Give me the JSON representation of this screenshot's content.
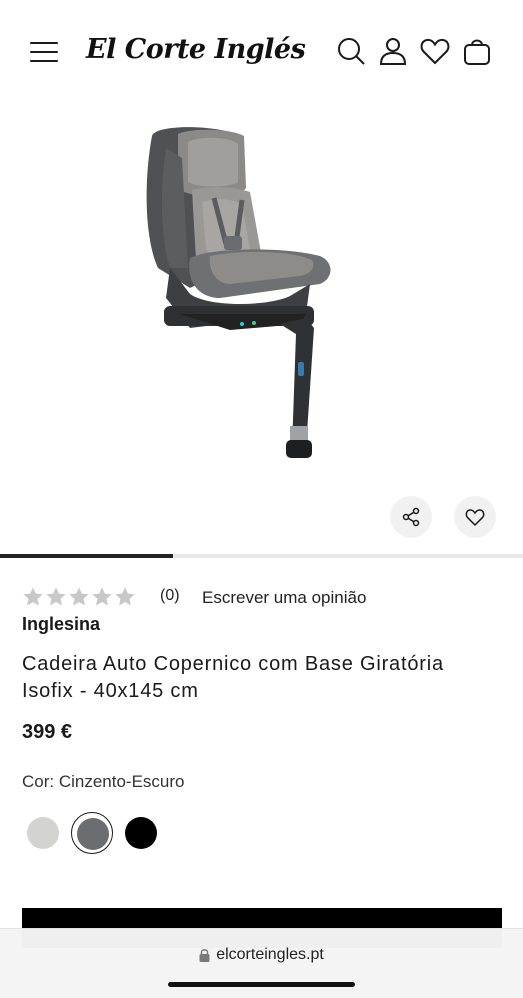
{
  "header": {
    "logo_text": "El Corte Inglés",
    "icons": [
      "menu-icon",
      "search-icon",
      "user-icon",
      "heart-icon",
      "bag-icon"
    ]
  },
  "gallery": {
    "image_alt": "Cadeira Auto Copernico com Base Giratória Isofix",
    "share_icon": "share-icon",
    "wishlist_icon": "heart-icon",
    "progress": 0.33
  },
  "rating": {
    "stars_filled": 0,
    "stars_total": 5,
    "count": "(0)",
    "write_review": "Escrever uma opinião"
  },
  "product": {
    "brand": "Inglesina",
    "title": "Cadeira Auto Copernico com Base Giratória Isofix - 40x145 cm",
    "price": "399 €",
    "color_label": "Cor: Cinzento-Escuro"
  },
  "swatches": [
    {
      "name": "Cinzento-Claro",
      "color": "#d3d3d0",
      "selected": false
    },
    {
      "name": "Cinzento-Escuro",
      "color": "#6b6e70",
      "selected": true
    },
    {
      "name": "Preto",
      "color": "#000000",
      "selected": false
    }
  ],
  "colors": {
    "accent": "#000000",
    "star_empty": "#c8c8c8",
    "button_bg": "#f1f1f1"
  },
  "browser": {
    "url": "elcorteingles.pt",
    "lock_icon": "lock-icon"
  }
}
